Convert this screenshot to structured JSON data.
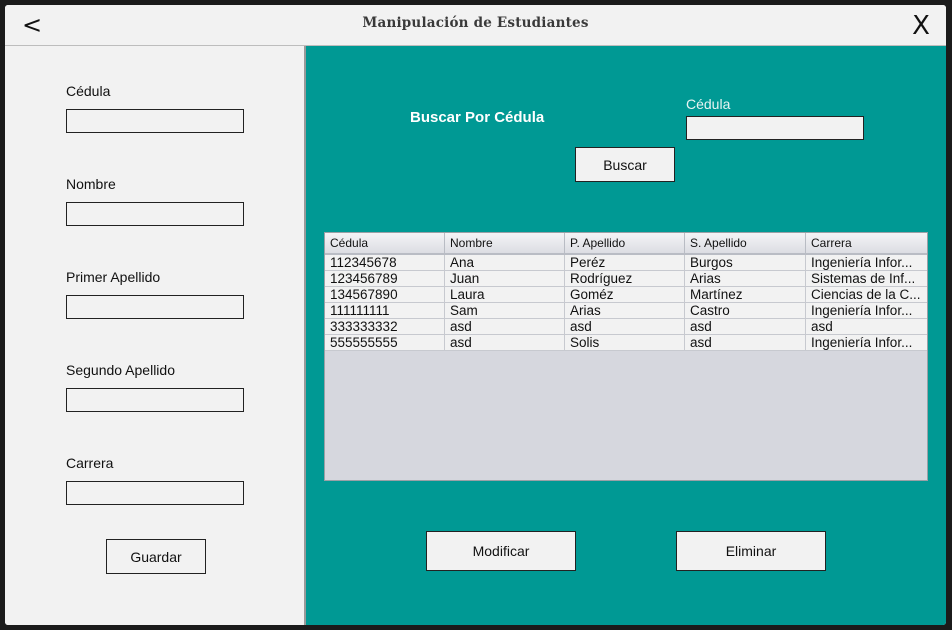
{
  "window": {
    "title": "Manipulación de Estudiantes",
    "back_icon": "back-arrow-icon",
    "close_icon": "close-icon",
    "back_glyph": "<",
    "close_glyph": "X"
  },
  "form": {
    "fields": [
      {
        "label": "Cédula",
        "value": ""
      },
      {
        "label": "Nombre",
        "value": ""
      },
      {
        "label": "Primer Apellido",
        "value": ""
      },
      {
        "label": "Segundo Apellido",
        "value": ""
      },
      {
        "label": "Carrera",
        "value": ""
      }
    ],
    "save_label": "Guardar"
  },
  "search": {
    "title": "Buscar Por Cédula",
    "field_label": "Cédula",
    "value": "",
    "button_label": "Buscar"
  },
  "table": {
    "columns": [
      "Cédula",
      "Nombre",
      "P. Apellido",
      "S. Apellido",
      "Carrera"
    ],
    "rows": [
      [
        "112345678",
        "Ana",
        "Peréz",
        "Burgos",
        "Ingeniería Infor..."
      ],
      [
        "123456789",
        "Juan",
        "Rodríguez",
        "Arias",
        "Sistemas de Inf..."
      ],
      [
        "134567890",
        "Laura",
        "Goméz",
        "Martínez",
        "Ciencias de la C..."
      ],
      [
        "111111111",
        "Sam",
        "Arias",
        "Castro",
        "Ingeniería Infor..."
      ],
      [
        "333333332",
        "asd",
        "asd",
        "asd",
        "asd"
      ],
      [
        "555555555",
        "asd",
        "Solis",
        "asd",
        "Ingeniería Infor..."
      ]
    ]
  },
  "actions": {
    "modify_label": "Modificar",
    "delete_label": "Eliminar"
  },
  "colors": {
    "accent": "#009994",
    "panel_bg": "#f2f2f2",
    "table_empty_bg": "#d6d7de"
  }
}
